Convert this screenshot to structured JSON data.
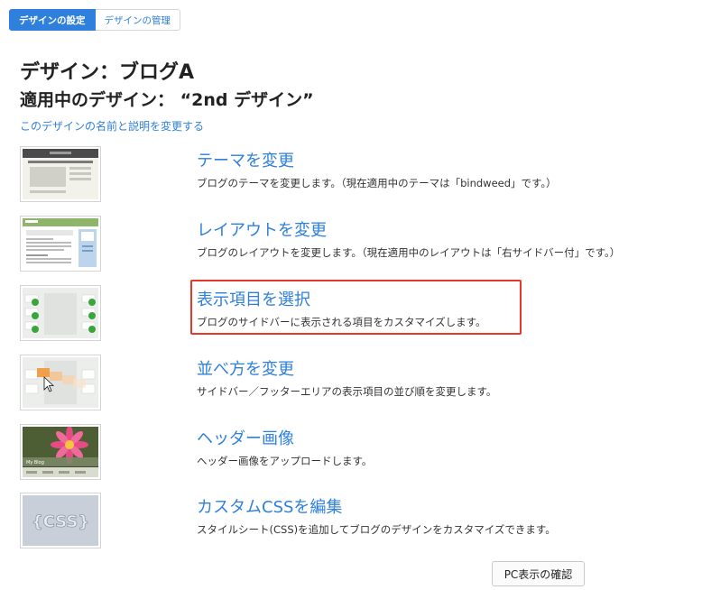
{
  "tabs": [
    {
      "label": "デザインの設定"
    },
    {
      "label": "デザインの管理"
    }
  ],
  "header": {
    "title": "デザイン：ブログA",
    "subtitle": "適用中のデザイン： “2nd デザイン”",
    "rename_link": "このデザインの名前と説明を変更する"
  },
  "items": [
    {
      "title": "テーマを変更",
      "desc": "ブログのテーマを変更します。（現在適用中のテーマは「bindweed」です。）",
      "thumb_icon": "theme-thumbnail"
    },
    {
      "title": "レイアウトを変更",
      "desc": "ブログのレイアウトを変更します。（現在適用中のレイアウトは「右サイドバー付」です。）",
      "thumb_icon": "layout-thumbnail"
    },
    {
      "title": "表示項目を選択",
      "desc": "ブログのサイドバーに表示される項目をカスタマイズします。",
      "thumb_icon": "checklist-thumbnail"
    },
    {
      "title": "並べ方を変更",
      "desc": "サイドバー／フッターエリアの表示項目の並び順を変更します。",
      "thumb_icon": "drag-reorder-thumbnail"
    },
    {
      "title": "ヘッダー画像",
      "desc": "ヘッダー画像をアップロードします。",
      "thumb_icon": "flower-header-thumbnail",
      "thumb_text": "My Blog"
    },
    {
      "title": "カスタムCSSを編集",
      "desc": "スタイルシート(CSS)を追加してブログのデザインをカスタマイズできます。",
      "thumb_icon": "css-thumbnail",
      "thumb_text": "{CSS}"
    }
  ],
  "footer": {
    "pc_preview_label": "PC表示の確認"
  },
  "colors": {
    "accent": "#2f80dc",
    "highlight": "#e8382a",
    "check": "#3aa63a"
  }
}
